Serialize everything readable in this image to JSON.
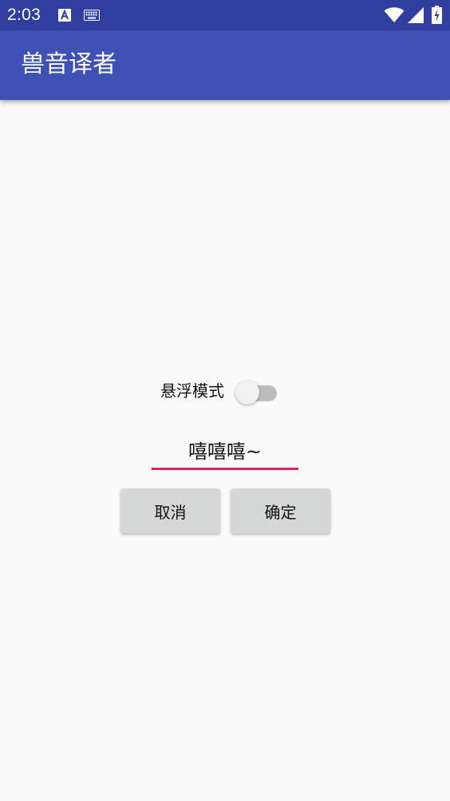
{
  "status_bar": {
    "time": "2:03",
    "icons": [
      "a-icon",
      "keyboard-icon",
      "wifi-icon",
      "signal-icon",
      "battery-icon"
    ],
    "background": "#303f9f"
  },
  "app_bar": {
    "title": "兽音译者",
    "background": "#3f51b5"
  },
  "main": {
    "float_mode_label": "悬浮模式",
    "float_mode_enabled": false,
    "input_value": "嘻嘻嘻~",
    "input_underline_color": "#e91e63",
    "cancel_label": "取消",
    "confirm_label": "确定"
  }
}
